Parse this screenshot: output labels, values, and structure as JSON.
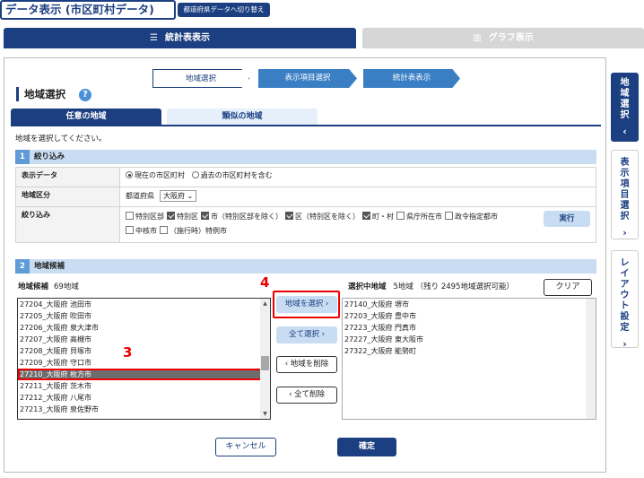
{
  "header": {
    "title": "データ表示 (市区町村データ)",
    "switch_label": "都道府県データへ切り替え"
  },
  "view_tabs": {
    "table": "統計表表示",
    "graph": "グラフ表示"
  },
  "steps": [
    "地域選択",
    "表示項目選択",
    "統計表表示"
  ],
  "section_title": "地域選択",
  "help_icon": "?",
  "area_tabs": {
    "any": "任意の地域",
    "similar": "類似の地域"
  },
  "instruction": "地域を選択してください。",
  "filter": {
    "num": "1",
    "title": "絞り込み",
    "display_data": {
      "label": "表示データ",
      "options": [
        "現在の市区町村",
        "過去の市区町村を含む"
      ]
    },
    "region": {
      "label": "地域区分",
      "pref_label": "都道府県",
      "pref_value": "大阪府 ⌄"
    },
    "narrow": {
      "label": "絞り込み",
      "items": [
        {
          "label": "特別区部",
          "checked": false
        },
        {
          "label": "特別区",
          "checked": true
        },
        {
          "label": "市（特別区部を除く）",
          "checked": true
        },
        {
          "label": "区（特別区を除く）",
          "checked": true
        },
        {
          "label": "町・村",
          "checked": true
        },
        {
          "label": "県庁所在市",
          "checked": false
        },
        {
          "label": "政令指定都市",
          "checked": false
        }
      ],
      "items2": [
        {
          "label": "中核市",
          "checked": false
        },
        {
          "label": "（施行時）特例市",
          "checked": false
        }
      ],
      "exec": "実行"
    }
  },
  "candidates_section": {
    "num": "2",
    "title": "地域候補"
  },
  "candidates": {
    "label": "地域候補",
    "count": "69地域",
    "items": [
      "27204_大阪府 池田市",
      "27205_大阪府 吹田市",
      "27206_大阪府 泉大津市",
      "27207_大阪府 高槻市",
      "27208_大阪府 貝塚市",
      "27209_大阪府 守口市",
      "27210_大阪府 枚方市",
      "27211_大阪府 茨木市",
      "27212_大阪府 八尾市",
      "27213_大阪府 泉佐野市"
    ],
    "selected_index": 6
  },
  "middle_buttons": {
    "add": "地域を選択 ›",
    "add_all": "全て選択 ›",
    "remove": "‹ 地域を削除",
    "remove_all": "‹ 全て削除"
  },
  "selected": {
    "label": "選択中地域",
    "count": "5地域 （残り 2495地域選択可能）",
    "clear": "クリア",
    "items": [
      "27140_大阪府 堺市",
      "27203_大阪府 豊中市",
      "27223_大阪府 門真市",
      "27227_大阪府 東大阪市",
      "27322_大阪府 能勢町"
    ]
  },
  "annotations": {
    "step3": "3",
    "step4": "4"
  },
  "footer": {
    "cancel": "キャンセル",
    "ok": "確定"
  },
  "side_tabs": {
    "area": "地域選択",
    "items": "表示項目選択",
    "layout": "レイアウト設定",
    "chev_left": "‹",
    "chev_right": "›"
  },
  "colors": {
    "navy": "#1b3f80",
    "light_blue": "#c8ddf2",
    "mid_blue": "#3a7fc4",
    "highlight_red": "#e00000"
  }
}
